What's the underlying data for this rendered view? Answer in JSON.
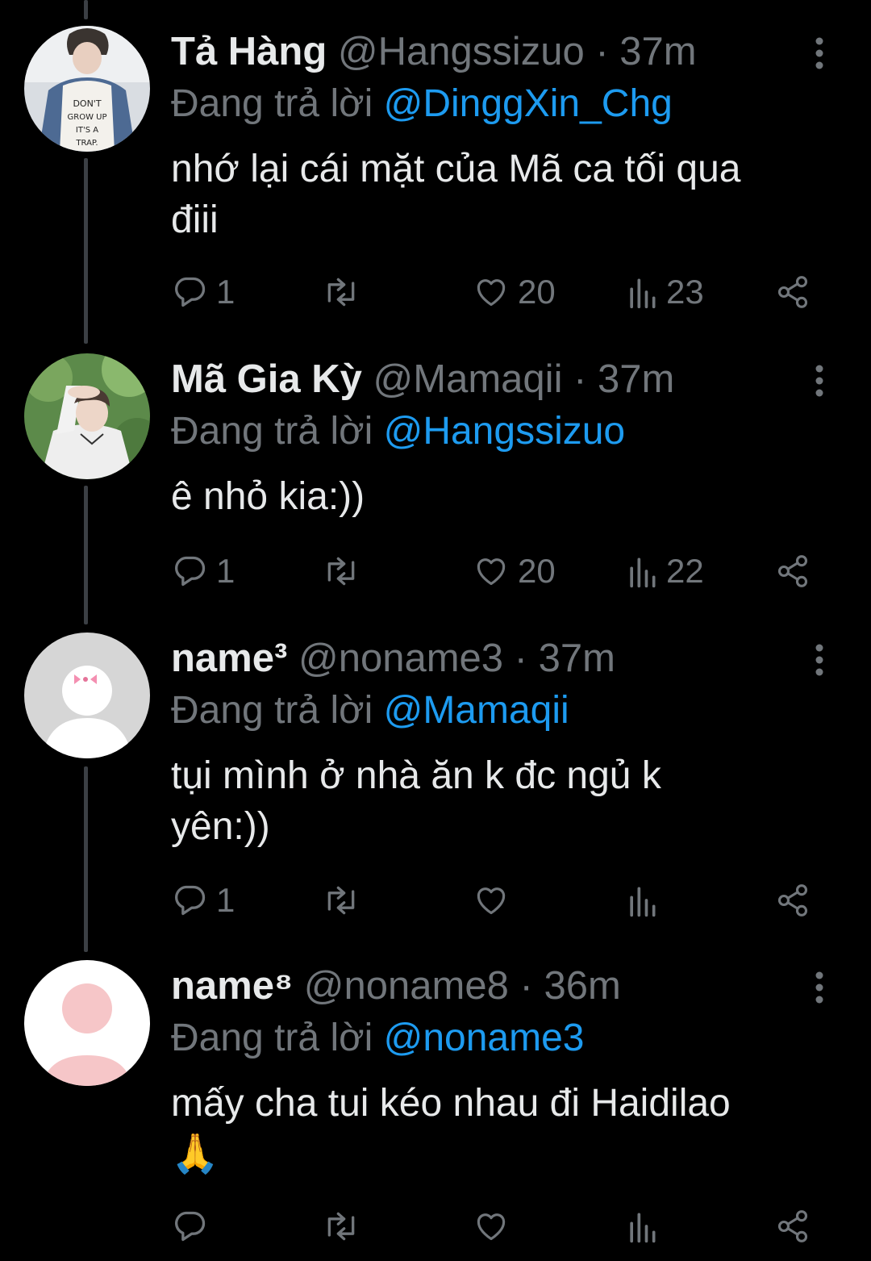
{
  "tweets": [
    {
      "name": "Tả Hàng",
      "handle": "@Hangssizuo",
      "separator": "·",
      "time": "37m",
      "reply_prefix": "Đang trả lời",
      "reply_to": "@DinggXin_Chg",
      "text_lines": [
        "nhớ lại cái mặt của Mã ca tối qua",
        "điii"
      ],
      "replies": "1",
      "retweets": "",
      "likes": "20",
      "views": "23",
      "avatar": "photo-boy-dont-grow-up-shirt"
    },
    {
      "name": "Mã Gia Kỳ",
      "handle": "@Mamaqii",
      "separator": "·",
      "time": "37m",
      "reply_prefix": "Đang trả lời",
      "reply_to": "@Hangssizuo",
      "text_lines": [
        "ê nhỏ kia:))"
      ],
      "replies": "1",
      "retweets": "",
      "likes": "20",
      "views": "22",
      "avatar": "photo-boy-white-jacket-outdoor"
    },
    {
      "name": "name³",
      "handle": "@noname3",
      "separator": "·",
      "time": "37m",
      "reply_prefix": "Đang trả lời",
      "reply_to": "@Mamaqii",
      "text_lines": [
        "tụi mình ở nhà ăn k đc ngủ k",
        "yên:))"
      ],
      "replies": "1",
      "retweets": "",
      "likes": "",
      "views": "",
      "avatar": "default-avatar-gray-bow"
    },
    {
      "name": "name⁸",
      "handle": "@noname8",
      "separator": "·",
      "time": "36m",
      "reply_prefix": "Đang trả lời",
      "reply_to": "@noname3",
      "text_lines": [
        "mấy cha tui kéo nhau đi Haidilao",
        "🙏"
      ],
      "replies": "",
      "retweets": "",
      "likes": "",
      "views": "",
      "avatar": "default-avatar-pink"
    }
  ],
  "icons": {
    "reply": "reply-bubble-icon",
    "retweet": "retweet-icon",
    "like": "heart-icon",
    "views": "views-bar-chart-icon",
    "share": "share-icon",
    "more": "more-vertical-icon"
  },
  "colors": {
    "background": "#000000",
    "text": "#e7e9ea",
    "muted": "#71767b",
    "link": "#1d9bf0",
    "thread_line": "#3b3f44"
  }
}
